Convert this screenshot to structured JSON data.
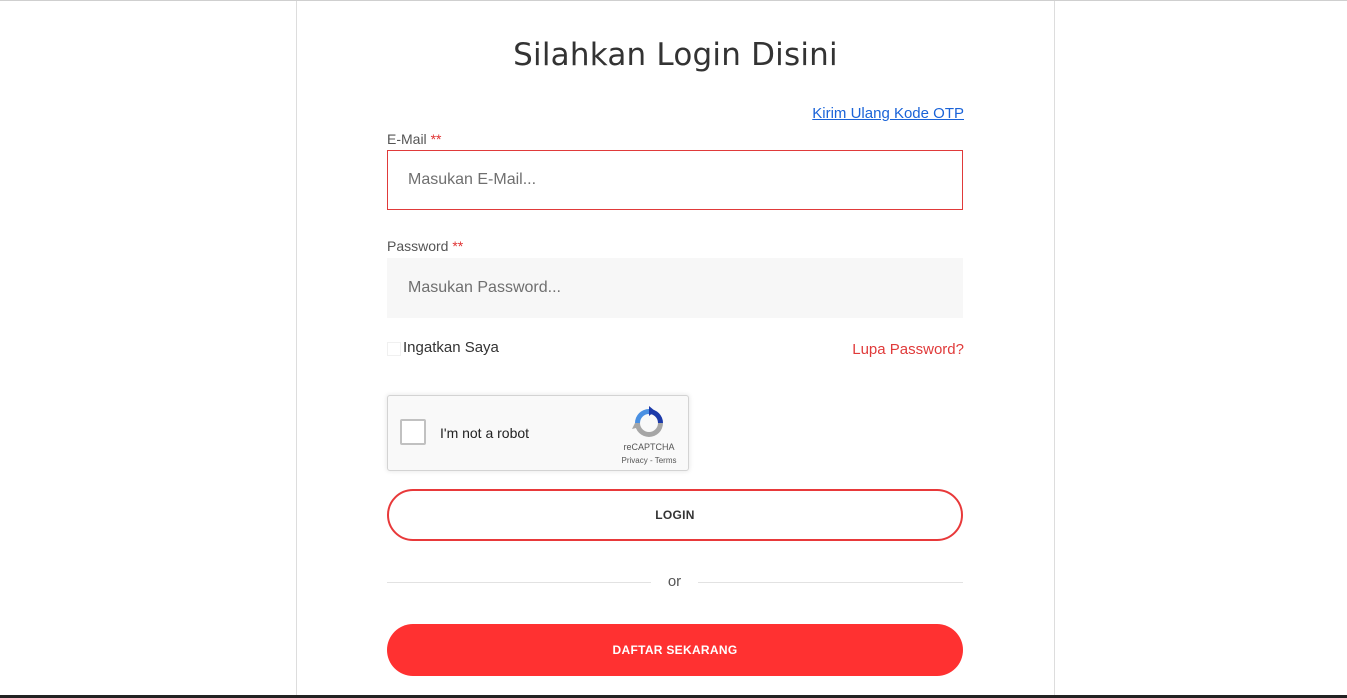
{
  "page": {
    "title": "Silahkan Login Disini",
    "resend_otp_link": "Kirim Ulang Kode OTP"
  },
  "form": {
    "email": {
      "label": "E-Mail",
      "required_mark": "**",
      "placeholder": "Masukan E-Mail...",
      "value": ""
    },
    "password": {
      "label": "Password",
      "required_mark": "**",
      "placeholder": "Masukan Password...",
      "value": ""
    },
    "remember_me_label": "Ingatkan Saya",
    "forgot_password_link": "Lupa Password?"
  },
  "captcha": {
    "label": "I'm not a robot",
    "brand": "reCAPTCHA",
    "links": "Privacy - Terms",
    "icon": "recaptcha-icon"
  },
  "actions": {
    "login_label": "LOGIN",
    "divider_text": "or",
    "register_label": "DAFTAR SEKARANG"
  },
  "colors": {
    "accent_red": "#ff3131",
    "error_border": "#e03a3a",
    "link_blue": "#1a63d8"
  }
}
